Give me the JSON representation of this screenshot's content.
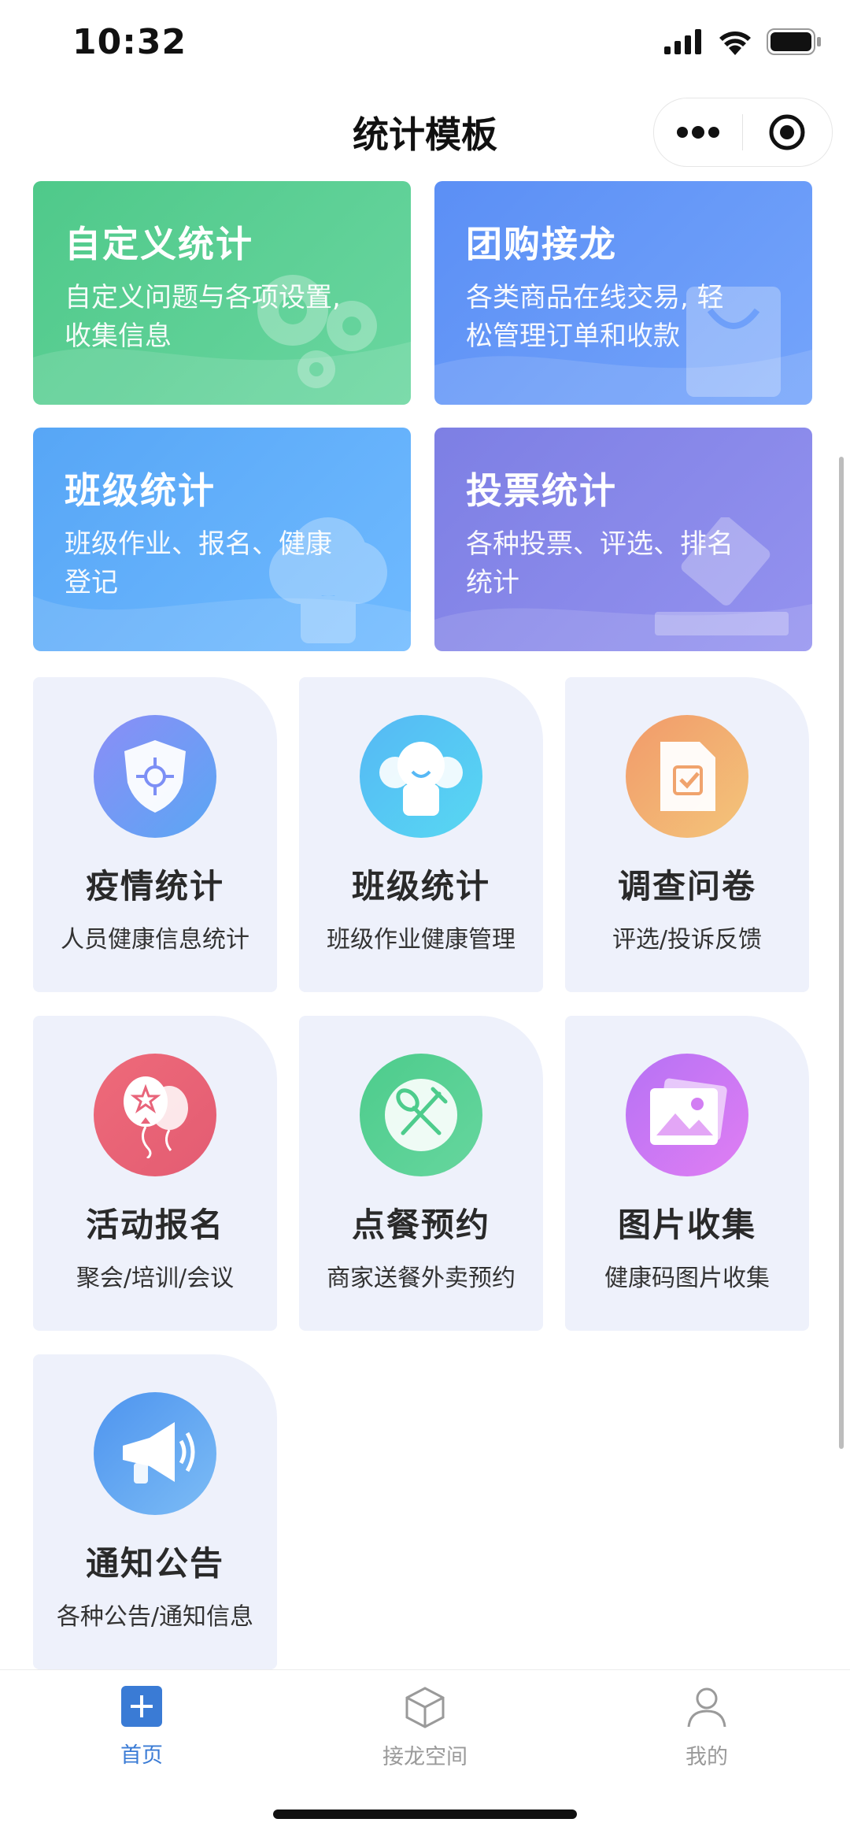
{
  "status_bar": {
    "time": "10:32"
  },
  "nav": {
    "title": "统计模板"
  },
  "cards": [
    {
      "title": "自定义统计",
      "desc": "自定义问题与各项设置, 收集信息",
      "color_from": "#4fc98a",
      "color_to": "#6ad6a0",
      "icon": "gears-icon"
    },
    {
      "title": "团购接龙",
      "desc": "各类商品在线交易, 轻松管理订单和收款",
      "color_from": "#5b8ff5",
      "color_to": "#74a4fb",
      "icon": "shopping-bag-icon"
    },
    {
      "title": "班级统计",
      "desc": "班级作业、报名、健康登记",
      "color_from": "#57a6f6",
      "color_to": "#6fbaff",
      "icon": "students-icon"
    },
    {
      "title": "投票统计",
      "desc": "各种投票、评选、排名统计",
      "color_from": "#7d7fe4",
      "color_to": "#9492ef",
      "icon": "ballot-box-icon"
    }
  ],
  "tiles": [
    {
      "title": "疫情统计",
      "desc": "人员健康信息统计",
      "icon": "shield-virus-icon",
      "color_from": "#8b8df6",
      "color_to": "#5aa7f4"
    },
    {
      "title": "班级统计",
      "desc": "班级作业健康管理",
      "icon": "students-icon",
      "color_from": "#56b8f5",
      "color_to": "#57d8f2"
    },
    {
      "title": "调查问卷",
      "desc": "评选/投诉反馈",
      "icon": "document-check-icon",
      "color_from": "#f29a6a",
      "color_to": "#f3c57a"
    },
    {
      "title": "活动报名",
      "desc": "聚会/培训/会议",
      "icon": "balloons-icon",
      "color_from": "#ee6a7a",
      "color_to": "#e35c72"
    },
    {
      "title": "点餐预约",
      "desc": "商家送餐外卖预约",
      "icon": "fork-spoon-icon",
      "color_from": "#4dcc8c",
      "color_to": "#66d69e"
    },
    {
      "title": "图片收集",
      "desc": "健康码图片收集",
      "icon": "pictures-icon",
      "color_from": "#b672f4",
      "color_to": "#e07ef3"
    },
    {
      "title": "通知公告",
      "desc": "各种公告/通知信息",
      "icon": "megaphone-icon",
      "color_from": "#4e94ef",
      "color_to": "#7cbcf5"
    }
  ],
  "tabbar": {
    "items": [
      {
        "label": "首页",
        "icon": "plus-square-icon",
        "active": true
      },
      {
        "label": "接龙空间",
        "icon": "cube-icon",
        "active": false
      },
      {
        "label": "我的",
        "icon": "person-icon",
        "active": false
      }
    ],
    "active_color": "#3a7bd5",
    "inactive_color": "#9a9a9a"
  }
}
